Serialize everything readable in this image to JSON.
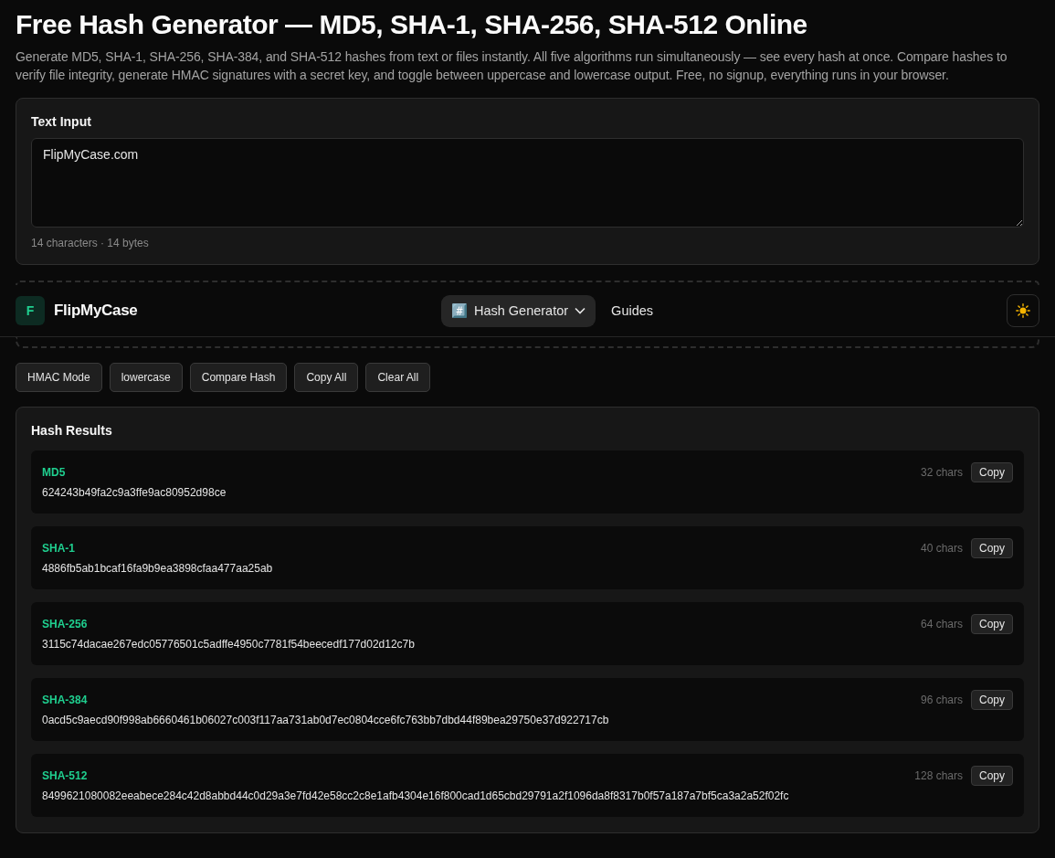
{
  "page": {
    "title": "Free Hash Generator — MD5, SHA-1, SHA-256, SHA-512 Online",
    "description": "Generate MD5, SHA-1, SHA-256, SHA-384, and SHA-512 hashes from text or files instantly. All five algorithms run simultaneously — see every hash at once. Compare hashes to verify file integrity, generate HMAC signatures with a secret key, and toggle between uppercase and lowercase output. Free, no signup, everything runs in your browser."
  },
  "text_input": {
    "label": "Text Input",
    "value": "FlipMyCase.com",
    "stats": "14 characters · 14 bytes"
  },
  "navbar": {
    "logo_letter": "F",
    "brand": "FlipMyCase",
    "menu": [
      {
        "icon": "#️⃣",
        "label": "Hash Generator",
        "dropdown": true,
        "selected": true
      },
      {
        "label": "Guides",
        "dropdown": false,
        "selected": false
      }
    ]
  },
  "toolbar": [
    "HMAC Mode",
    "lowercase",
    "Compare Hash",
    "Copy All",
    "Clear All"
  ],
  "results": {
    "title": "Hash Results",
    "items": [
      {
        "algorithm": "MD5",
        "length": "32 chars",
        "copy": "Copy",
        "hash": "624243b49fa2c9a3ffe9ac80952d98ce"
      },
      {
        "algorithm": "SHA-1",
        "length": "40 chars",
        "copy": "Copy",
        "hash": "4886fb5ab1bcaf16fa9b9ea3898cfaa477aa25ab"
      },
      {
        "algorithm": "SHA-256",
        "length": "64 chars",
        "copy": "Copy",
        "hash": "3115c74dacae267edc05776501c5adffe4950c7781f54beecedf177d02d12c7b"
      },
      {
        "algorithm": "SHA-384",
        "length": "96 chars",
        "copy": "Copy",
        "hash": "0acd5c9aecd90f998ab6660461b06027c003f117aa731ab0d7ec0804cce6fc763bb7dbd44f89bea29750e37d922717cb"
      },
      {
        "algorithm": "SHA-512",
        "length": "128 chars",
        "copy": "Copy",
        "hash": "8499621080082eeabece284c42d8abbd44c0d29a3e7fd42e58cc2c8e1afb4304e16f800cad1d65cbd29791a2f1096da8f8317b0f57a187a7bf5ca3a2a52f02fc"
      }
    ]
  }
}
